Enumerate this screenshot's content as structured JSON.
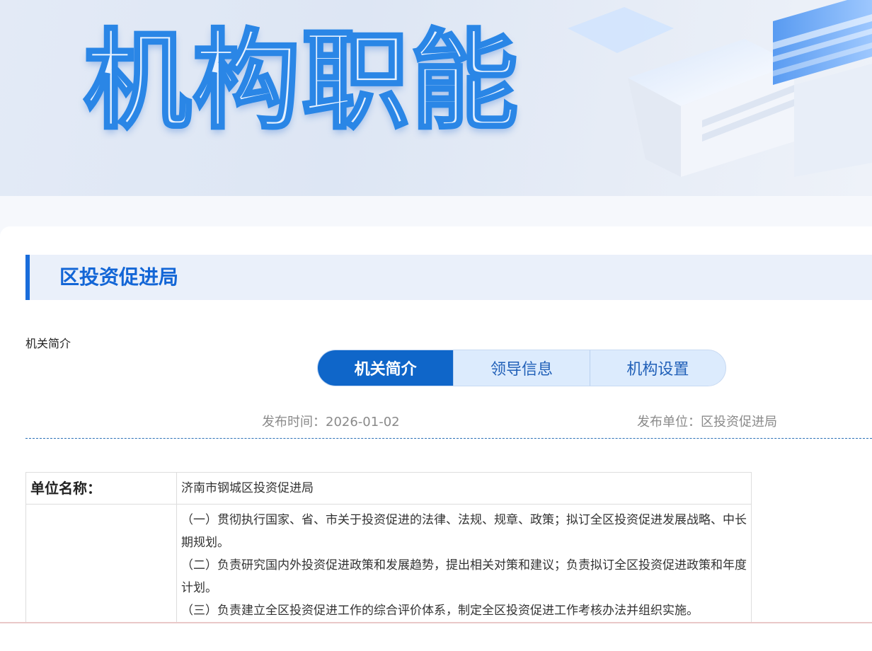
{
  "banner": {
    "title": "机构职能"
  },
  "section": {
    "title": "区投资促进局"
  },
  "breadcrumb": "机关简介",
  "tabs": [
    {
      "label": "机关简介",
      "active": true
    },
    {
      "label": "领导信息",
      "active": false
    },
    {
      "label": "机构设置",
      "active": false
    }
  ],
  "meta": {
    "publish_time": "发布时间：2026-01-02",
    "publish_unit": "发布单位：区投资促进局"
  },
  "info": {
    "name_label": "单位名称：",
    "name_value": "济南市钢城区投资促进局",
    "duties": [
      "（一）贯彻执行国家、省、市关于投资促进的法律、法规、规章、政策；拟订全区投资促进发展战略、中长期规划。",
      "（二）负责研究国内外投资促进政策和发展趋势，提出相关对策和建议；负责拟订全区投资促进政策和年度计划。",
      "（三）负责建立全区投资促进工作的综合评价体系，制定全区投资促进工作考核办法并组织实施。"
    ]
  },
  "colors": {
    "accent": "#1366d6",
    "tab_active": "#0f66c9",
    "tab_inactive": "#dcebfd",
    "section_bg": "#eaf0fa"
  }
}
